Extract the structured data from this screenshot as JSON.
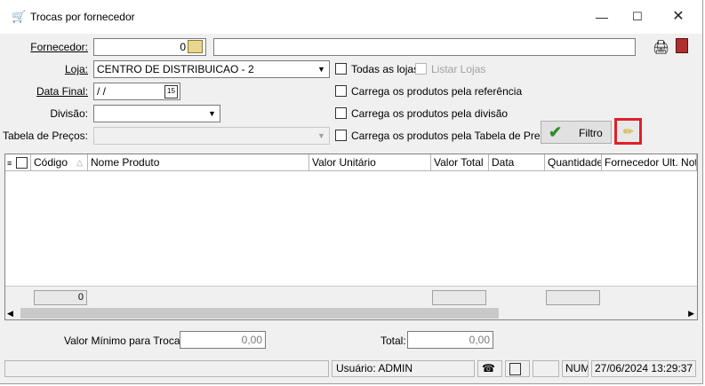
{
  "window": {
    "title": "Trocas por fornecedor"
  },
  "form": {
    "fornecedor": {
      "label": "Fornecedor:",
      "code": "0",
      "name": ""
    },
    "loja": {
      "label": "Loja:",
      "value": "CENTRO DE DISTRIBUICAO - 2"
    },
    "data_final": {
      "label": "Data Final:",
      "value": " /  /"
    },
    "divisao": {
      "label": "Divisão:",
      "value": ""
    },
    "tabela_precos": {
      "label": "Tabela de Preços:",
      "value": ""
    }
  },
  "options": {
    "todas_lojas": "Todas as lojas",
    "listar_lojas": "Listar Lojas",
    "carrega_referencia": "Carrega os produtos pela referência",
    "carrega_divisao": "Carrega os produtos pela divisão",
    "carrega_tabela": "Carrega os produtos pela Tabela de Preços"
  },
  "buttons": {
    "filtro": "Filtro"
  },
  "grid": {
    "columns": [
      "Código",
      "Nome Produto",
      "Valor Unitário",
      "Valor Total",
      "Data",
      "Quantidade",
      "Fornecedor Ult. Nota"
    ],
    "rows": [],
    "footer_count": "0"
  },
  "totals": {
    "valor_minimo_label": "Valor Mínimo para Trocas:",
    "valor_minimo": "0,00",
    "total_label": "Total:",
    "total": "0,00"
  },
  "statusbar": {
    "usuario": "Usuário: ADMIN",
    "num": "NUM",
    "datetime": "27/06/2024 13:29:37"
  },
  "colors": {
    "highlight": "#e0202a",
    "check_green": "#2e8b2e",
    "accent": "#2a7fd0"
  }
}
